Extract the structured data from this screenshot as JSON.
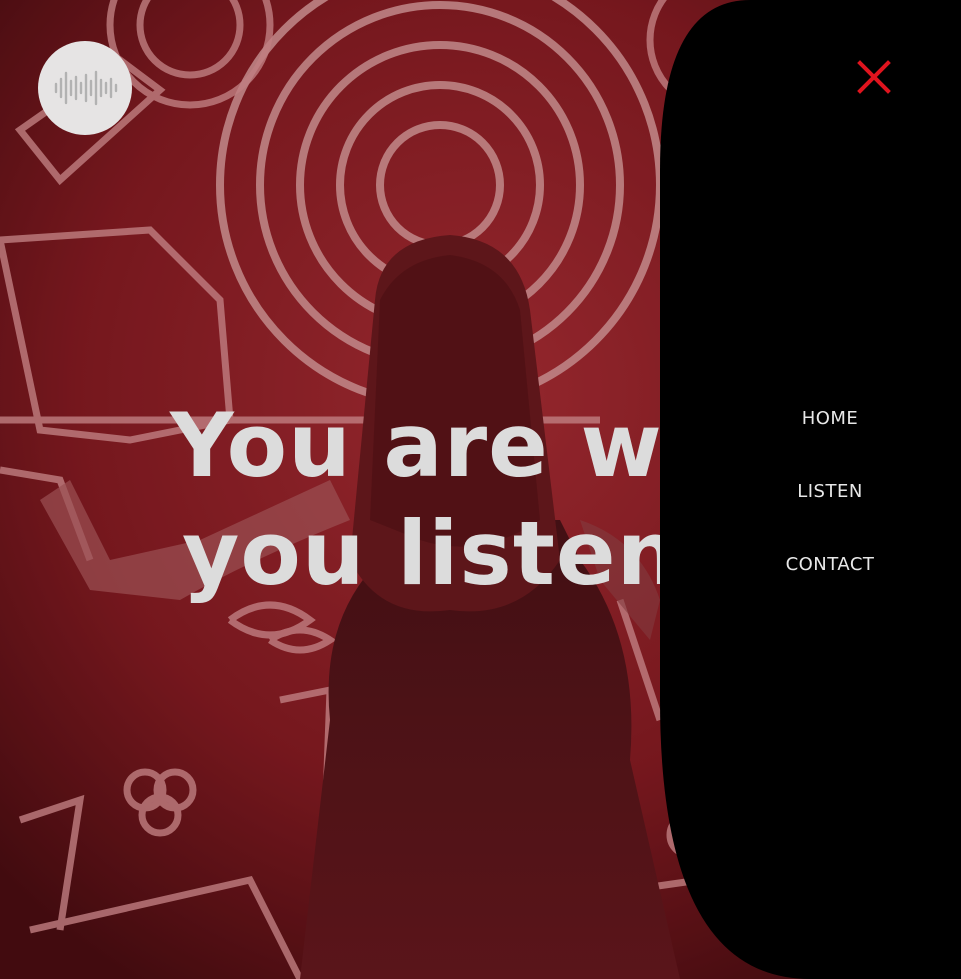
{
  "brand": {
    "logo_icon": "sound-wave-icon"
  },
  "hero": {
    "line1": "You are wh",
    "line2": "you listen"
  },
  "menu": {
    "close_icon": "close-icon",
    "close_color": "#e0141e",
    "items": [
      {
        "label": "HOME"
      },
      {
        "label": "LISTEN"
      },
      {
        "label": "CONTACT"
      }
    ]
  },
  "colors": {
    "panel": "#000000",
    "accent": "#e0141e",
    "text": "#e8e8e8"
  }
}
